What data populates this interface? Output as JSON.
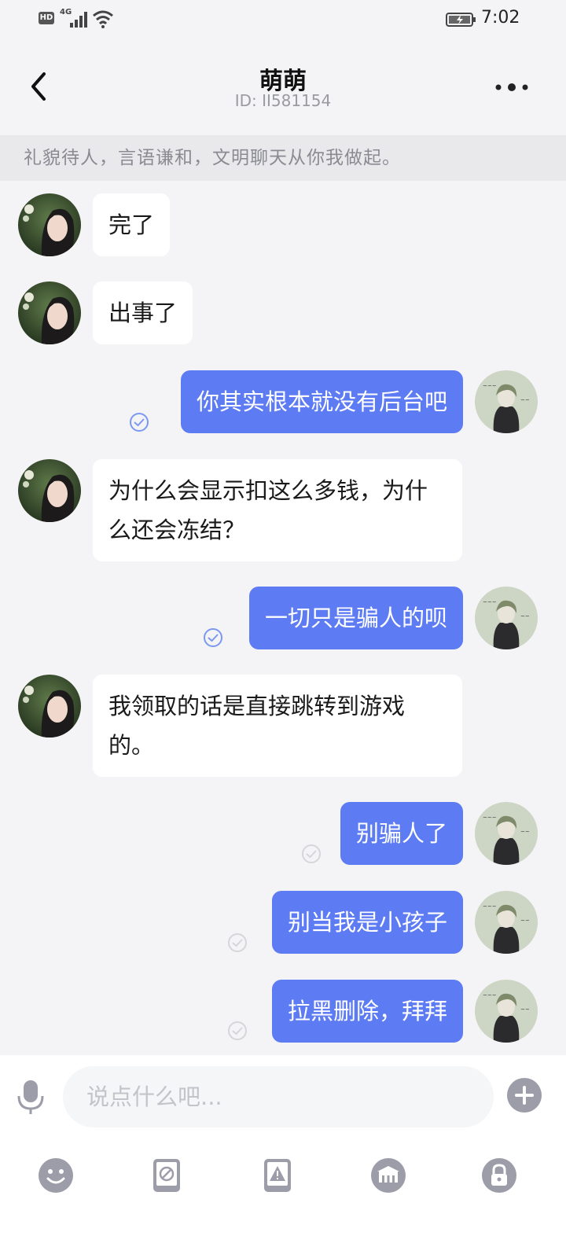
{
  "status_bar": {
    "hd_badge": "HD",
    "network": "4G",
    "time": "7:02",
    "icons": [
      "hd-icon",
      "signal-icon",
      "wifi-icon",
      "battery-charging-icon"
    ]
  },
  "header": {
    "back_icon": "chevron-left-icon",
    "contact_name": "萌萌",
    "contact_id": "ID: II581154",
    "more_icon": "more-dots-icon"
  },
  "notice": {
    "text": "礼貌待人，言语谦和，文明聊天从你我做起。"
  },
  "messages": [
    {
      "sender": "peer",
      "text": "完了"
    },
    {
      "sender": "peer",
      "text": "出事了"
    },
    {
      "sender": "me",
      "text": "你其实根本就没有后台吧",
      "receipt": "read"
    },
    {
      "sender": "peer",
      "text": "为什么会显示扣这么多钱，为什么还会冻结？"
    },
    {
      "sender": "me",
      "text": "一切只是骗人的呗",
      "receipt": "read"
    },
    {
      "sender": "peer",
      "text": "我领取的话是直接跳转到游戏的。"
    },
    {
      "sender": "me",
      "text": "别骗人了",
      "receipt": "unread"
    },
    {
      "sender": "me",
      "text": "别当我是小孩子",
      "receipt": "unread"
    },
    {
      "sender": "me",
      "text": "拉黑删除，拜拜",
      "receipt": "unread"
    }
  ],
  "composer": {
    "placeholder": "说点什么吧...",
    "mic_icon": "microphone-icon",
    "plus_icon": "plus-circle-icon",
    "tools": [
      "emoji-icon",
      "block-card-icon",
      "warning-card-icon",
      "gift-shop-icon",
      "lock-icon"
    ]
  },
  "colors": {
    "accent": "#5d7bf2",
    "background": "#f4f4f6",
    "read_receipt": "#7b98f0",
    "unread_receipt": "#d6d6da",
    "tool_icon": "#9d9daa"
  }
}
